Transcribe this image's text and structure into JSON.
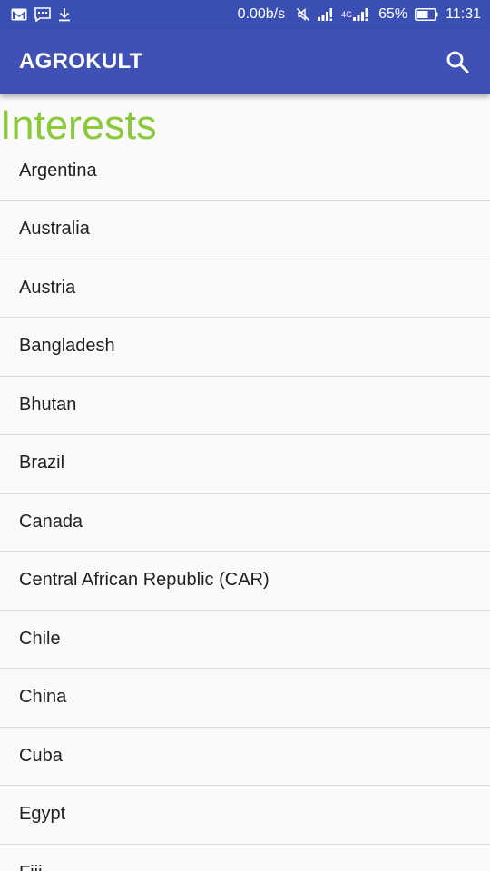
{
  "status_bar": {
    "net_speed": "0.00b/s",
    "network_type": "4G",
    "battery": "65%",
    "time": "11:31",
    "icons": [
      "gmail-icon",
      "message-icon",
      "download-icon",
      "mute-icon",
      "signal-icon",
      "signal-4g-icon",
      "battery-icon"
    ]
  },
  "app_bar": {
    "title": "AGROKULT",
    "search_icon": "search-icon",
    "color": "#3f51b5"
  },
  "page": {
    "heading": "Interests",
    "heading_color": "#8bc83a"
  },
  "interests": [
    "Argentina",
    "Australia",
    "Austria",
    "Bangladesh",
    "Bhutan",
    "Brazil",
    "Canada",
    "Central African Republic (CAR)",
    "Chile",
    "China",
    "Cuba",
    "Egypt",
    "Fiji"
  ]
}
